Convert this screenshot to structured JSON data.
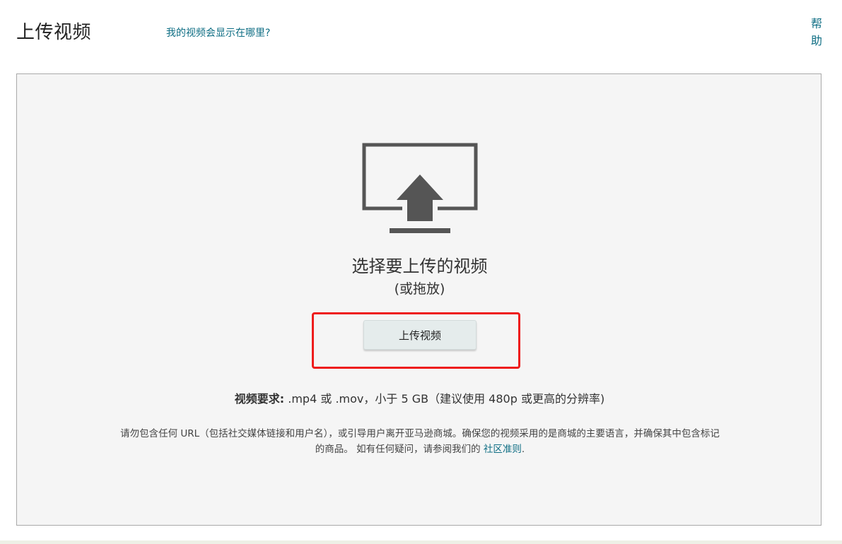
{
  "header": {
    "title": "上传视频",
    "where_link": "我的视频会显示在哪里?",
    "help_link": "帮助"
  },
  "drop_zone": {
    "icon": "monitor-upload-icon",
    "choose_title": "选择要上传的视频",
    "or_drop": "(或拖放)",
    "upload_button": "上传视频",
    "requirements_label": "视频要求:",
    "requirements_text": " .mp4 或 .mov，小于 5 GB（建议使用 480p 或更高的分辨率)",
    "guidelines_text_1": "请勿包含任何 URL（包括社交媒体链接和用户名），或引导用户离开亚马逊商城。确保您的视频采用的是商城的主要语言，并确保其中包含标记的商品。 如有任何疑问，请参阅我们的 ",
    "guidelines_link": "社区准则",
    "guidelines_text_2": "."
  },
  "colors": {
    "link": "#0f6e84",
    "highlight": "#ee1c1c",
    "icon": "#555555",
    "drop_zone_bg": "#f5f5f5"
  }
}
